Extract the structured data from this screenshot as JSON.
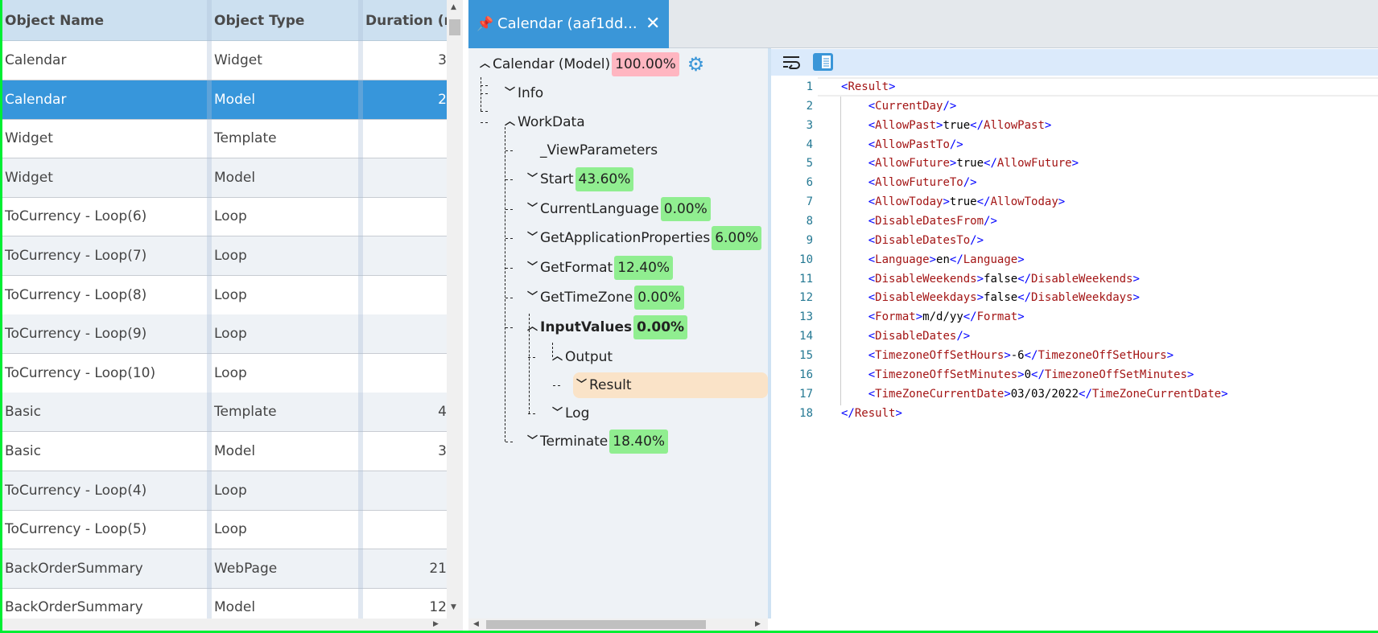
{
  "grid": {
    "columns": [
      "Object Name",
      "Object Type",
      "Duration (ms)"
    ],
    "rows": [
      {
        "name": "Calendar",
        "type": "Widget",
        "duration": "3"
      },
      {
        "name": "Calendar",
        "type": "Model",
        "duration": "2",
        "selected": true
      },
      {
        "name": "Widget",
        "type": "Template",
        "duration": ""
      },
      {
        "name": "Widget",
        "type": "Model",
        "duration": ""
      },
      {
        "name": "ToCurrency - Loop(6)",
        "type": "Loop",
        "duration": ""
      },
      {
        "name": "ToCurrency - Loop(7)",
        "type": "Loop",
        "duration": ""
      },
      {
        "name": "ToCurrency - Loop(8)",
        "type": "Loop",
        "duration": ""
      },
      {
        "name": "ToCurrency - Loop(9)",
        "type": "Loop",
        "duration": ""
      },
      {
        "name": "ToCurrency - Loop(10)",
        "type": "Loop",
        "duration": ""
      },
      {
        "name": "Basic",
        "type": "Template",
        "duration": "4"
      },
      {
        "name": "Basic",
        "type": "Model",
        "duration": "3"
      },
      {
        "name": "ToCurrency - Loop(4)",
        "type": "Loop",
        "duration": ""
      },
      {
        "name": "ToCurrency - Loop(5)",
        "type": "Loop",
        "duration": ""
      },
      {
        "name": "BackOrderSummary",
        "type": "WebPage",
        "duration": "21"
      },
      {
        "name": "BackOrderSummary",
        "type": "Model",
        "duration": "12"
      }
    ]
  },
  "tab": {
    "title": "Calendar (aaf1dd...",
    "pin_icon": "pin-icon",
    "close_icon": "close-icon"
  },
  "tree": {
    "nodes": [
      {
        "label": "Calendar (Model)",
        "pct": "100.00%",
        "chev": "up",
        "level": 0,
        "badge": "red",
        "gear": true
      },
      {
        "label": "Info",
        "chev": "down",
        "level": 1
      },
      {
        "label": "WorkData",
        "chev": "up",
        "level": 1
      },
      {
        "label": "_ViewParameters",
        "chev": "",
        "level": 2
      },
      {
        "label": "Start",
        "pct": "43.60%",
        "chev": "down",
        "level": 2
      },
      {
        "label": "CurrentLanguage",
        "pct": "0.00%",
        "chev": "down",
        "level": 2
      },
      {
        "label": "GetApplicationProperties",
        "pct": "6.00%",
        "chev": "down",
        "level": 2
      },
      {
        "label": "GetFormat",
        "pct": "12.40%",
        "chev": "down",
        "level": 2
      },
      {
        "label": "GetTimeZone",
        "pct": "0.00%",
        "chev": "down",
        "level": 2
      },
      {
        "label": "InputValues",
        "pct": "0.00%",
        "chev": "up",
        "level": 2,
        "bold": true
      },
      {
        "label": "Output",
        "chev": "up",
        "level": 3
      },
      {
        "label": "Result",
        "chev": "down",
        "level": 4,
        "highlight": true
      },
      {
        "label": "Log",
        "chev": "down",
        "level": 3
      },
      {
        "label": "Terminate",
        "pct": "18.40%",
        "chev": "down",
        "level": 2
      }
    ]
  },
  "colors": {
    "accent": "#3a96d8",
    "badge_green": "#90ee90",
    "badge_red": "#ffb6c1",
    "highlight": "#fae3c8",
    "frame": "#00ee33"
  },
  "editor": {
    "toolbar": [
      "word-wrap-icon",
      "panel-toggle-icon"
    ],
    "lines": [
      "<Result>",
      "    <CurrentDay/>",
      "    <AllowPast>true</AllowPast>",
      "    <AllowPastTo/>",
      "    <AllowFuture>true</AllowFuture>",
      "    <AllowFutureTo/>",
      "    <AllowToday>true</AllowToday>",
      "    <DisableDatesFrom/>",
      "    <DisableDatesTo/>",
      "    <Language>en</Language>",
      "    <DisableWeekends>false</DisableWeekends>",
      "    <DisableWeekdays>false</DisableWeekdays>",
      "    <Format>m/d/yy</Format>",
      "    <DisableDates/>",
      "    <TimezoneOffSetHours>-6</TimezoneOffSetHours>",
      "    <TimezoneOffSetMinutes>0</TimezoneOffSetMinutes>",
      "    <TimeZoneCurrentDate>03/03/2022</TimeZoneCurrentDate>",
      "</Result>"
    ]
  }
}
